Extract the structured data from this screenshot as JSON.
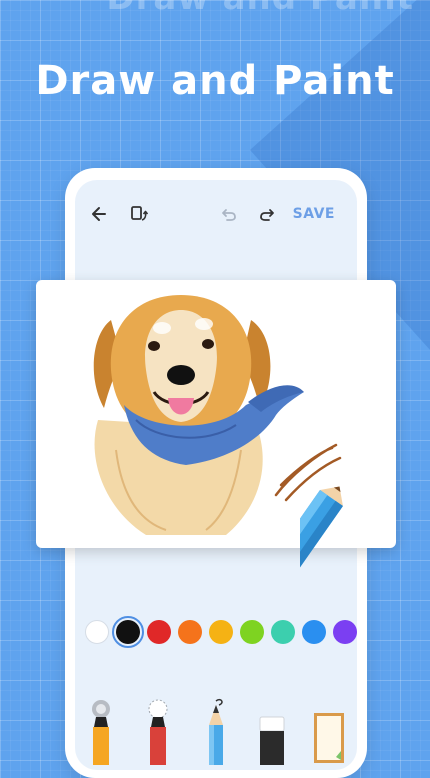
{
  "banner": {
    "ghost_title": "Draw and Paint",
    "title": "Draw and Paint"
  },
  "toolbar": {
    "back_icon": "arrow-left-icon",
    "rotate_icon": "rotate-screen-icon",
    "undo_icon": "undo-icon",
    "redo_icon": "redo-icon",
    "save_label": "SAVE"
  },
  "canvas": {
    "subject": "dog-illustration"
  },
  "palette": {
    "colors": [
      "#ffffff",
      "#111111",
      "#e02828",
      "#f5731b",
      "#f5b214",
      "#7ed321",
      "#3ccfae",
      "#2a8ff0",
      "#7b3ff2"
    ],
    "selected_index": 1
  },
  "tools": [
    "marker",
    "crayon",
    "pencil",
    "eraser",
    "paper"
  ],
  "colors": {
    "background": "#5fa3ee",
    "accent": "#6d9fe6"
  }
}
